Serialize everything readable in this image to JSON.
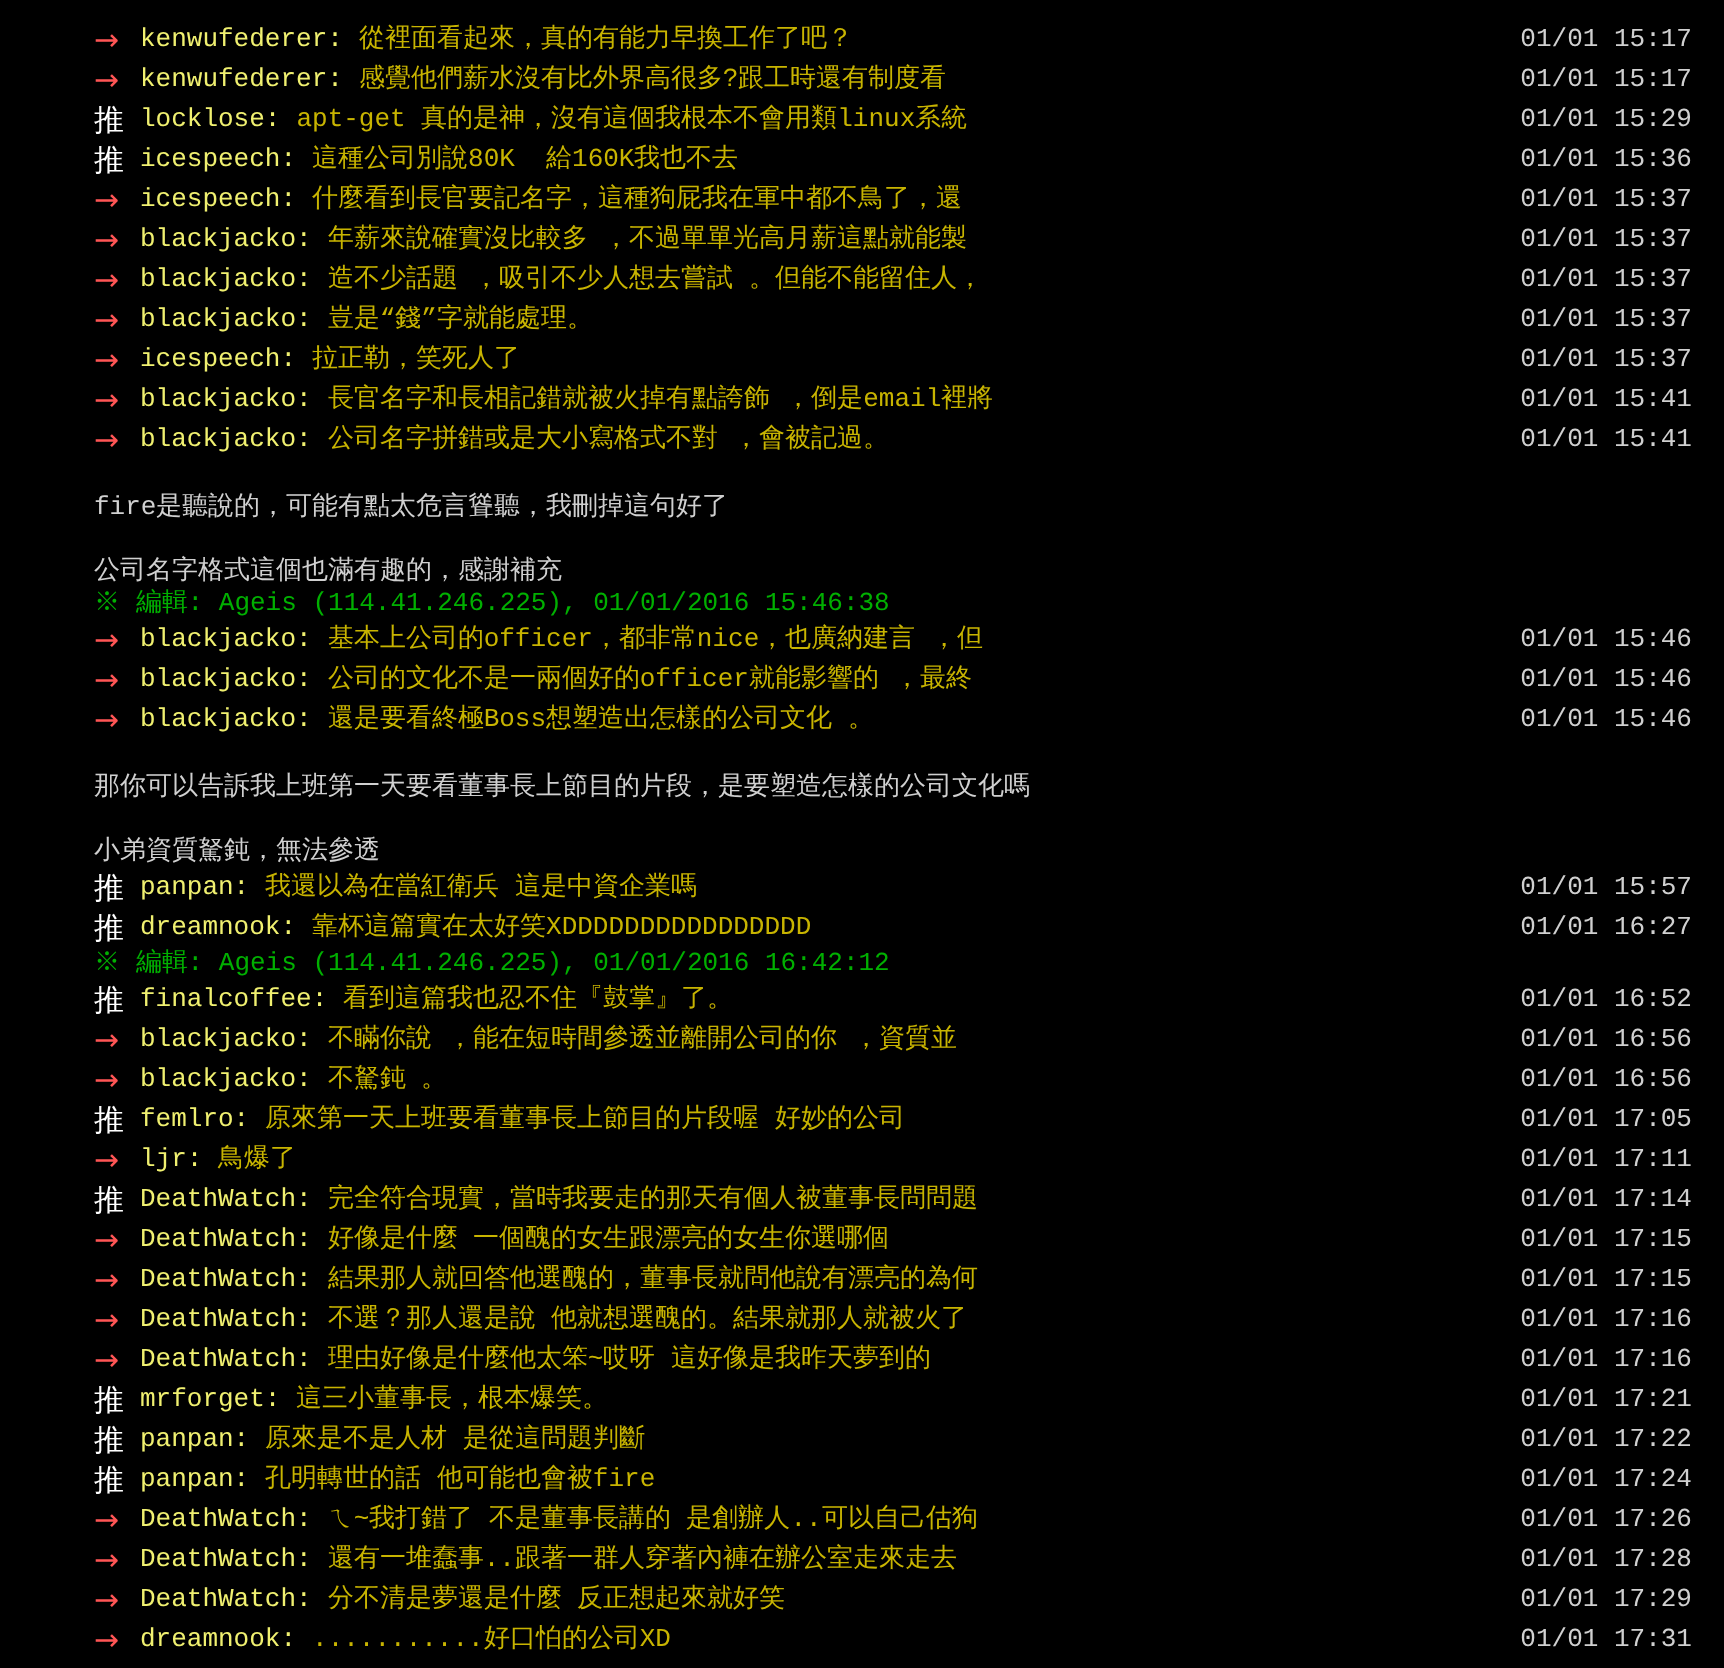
{
  "lines": [
    {
      "kind": "push",
      "tag": {
        "text": "→",
        "kind": "arrow"
      },
      "user": "kenwufederer:",
      "content": "從裡面看起來，真的有能力早換工作了吧？",
      "time": "01/01 15:17"
    },
    {
      "kind": "push",
      "tag": {
        "text": "→",
        "kind": "arrow"
      },
      "user": "kenwufederer:",
      "content": "感覺他們薪水沒有比外界高很多?跟工時還有制度看",
      "time": "01/01 15:17"
    },
    {
      "kind": "push",
      "tag": {
        "text": "推",
        "kind": "up"
      },
      "user": "locklose:",
      "content": "apt-get 真的是神，沒有這個我根本不會用類linux系統",
      "time": "01/01 15:29"
    },
    {
      "kind": "push",
      "tag": {
        "text": "推",
        "kind": "up"
      },
      "user": "icespeech:",
      "content": "這種公司別說80K  給160K我也不去",
      "time": "01/01 15:36"
    },
    {
      "kind": "push",
      "tag": {
        "text": "→",
        "kind": "arrow"
      },
      "user": "icespeech:",
      "content": "什麼看到長官要記名字，這種狗屁我在軍中都不鳥了，還",
      "time": "01/01 15:37"
    },
    {
      "kind": "push",
      "tag": {
        "text": "→",
        "kind": "arrow"
      },
      "user": "blackjacko:",
      "content": "年薪來說確實沒比較多 ，不過單單光高月薪這點就能製",
      "time": "01/01 15:37"
    },
    {
      "kind": "push",
      "tag": {
        "text": "→",
        "kind": "arrow"
      },
      "user": "blackjacko:",
      "content": "造不少話題 ，吸引不少人想去嘗試 。但能不能留住人，",
      "time": "01/01 15:37"
    },
    {
      "kind": "push",
      "tag": {
        "text": "→",
        "kind": "arrow"
      },
      "user": "blackjacko:",
      "content": "豈是“錢”字就能處理。",
      "time": "01/01 15:37"
    },
    {
      "kind": "push",
      "tag": {
        "text": "→",
        "kind": "arrow"
      },
      "user": "icespeech:",
      "content": "拉正勒，笑死人了",
      "time": "01/01 15:37"
    },
    {
      "kind": "push",
      "tag": {
        "text": "→",
        "kind": "arrow"
      },
      "user": "blackjacko:",
      "content": "長官名字和長相記錯就被火掉有點誇飾 ，倒是email裡將",
      "time": "01/01 15:41"
    },
    {
      "kind": "push",
      "tag": {
        "text": "→",
        "kind": "arrow"
      },
      "user": "blackjacko:",
      "content": "公司名字拼錯或是大小寫格式不對 ，會被記過。",
      "time": "01/01 15:41"
    },
    {
      "kind": "blank"
    },
    {
      "kind": "text",
      "text": "fire是聽說的，可能有點太危言聳聽，我刪掉這句好了"
    },
    {
      "kind": "blank"
    },
    {
      "kind": "text",
      "text": "公司名字格式這個也滿有趣的，感謝補充"
    },
    {
      "kind": "edit",
      "text": "※ 編輯: Ageis (114.41.246.225), 01/01/2016 15:46:38"
    },
    {
      "kind": "push",
      "tag": {
        "text": "→",
        "kind": "arrow"
      },
      "user": "blackjacko:",
      "content": "基本上公司的officer，都非常nice，也廣納建言 ，但",
      "time": "01/01 15:46"
    },
    {
      "kind": "push",
      "tag": {
        "text": "→",
        "kind": "arrow"
      },
      "user": "blackjacko:",
      "content": "公司的文化不是一兩個好的officer就能影響的 ，最終",
      "time": "01/01 15:46"
    },
    {
      "kind": "push",
      "tag": {
        "text": "→",
        "kind": "arrow"
      },
      "user": "blackjacko:",
      "content": "還是要看終極Boss想塑造出怎樣的公司文化 。",
      "time": "01/01 15:46"
    },
    {
      "kind": "blank"
    },
    {
      "kind": "text",
      "text": "那你可以告訴我上班第一天要看董事長上節目的片段，是要塑造怎樣的公司文化嗎"
    },
    {
      "kind": "blank"
    },
    {
      "kind": "text",
      "text": "小弟資質駑鈍，無法參透"
    },
    {
      "kind": "push",
      "tag": {
        "text": "推",
        "kind": "up"
      },
      "user": "panpan:",
      "content": "我還以為在當紅衛兵 這是中資企業嗎",
      "time": "01/01 15:57"
    },
    {
      "kind": "push",
      "tag": {
        "text": "推",
        "kind": "up"
      },
      "user": "dreamnook:",
      "content": "靠杯這篇實在太好笑XDDDDDDDDDDDDDDDD",
      "time": "01/01 16:27"
    },
    {
      "kind": "edit",
      "text": "※ 編輯: Ageis (114.41.246.225), 01/01/2016 16:42:12"
    },
    {
      "kind": "push",
      "tag": {
        "text": "推",
        "kind": "up"
      },
      "user": "finalcoffee:",
      "content": "看到這篇我也忍不住『鼓掌』了。",
      "time": "01/01 16:52"
    },
    {
      "kind": "push",
      "tag": {
        "text": "→",
        "kind": "arrow"
      },
      "user": "blackjacko:",
      "content": "不瞞你說 ，能在短時間參透並離開公司的你 ，資質並",
      "time": "01/01 16:56"
    },
    {
      "kind": "push",
      "tag": {
        "text": "→",
        "kind": "arrow"
      },
      "user": "blackjacko:",
      "content": "不駑鈍 。",
      "time": "01/01 16:56"
    },
    {
      "kind": "push",
      "tag": {
        "text": "推",
        "kind": "up"
      },
      "user": "femlro:",
      "content": "原來第一天上班要看董事長上節目的片段喔 好妙的公司",
      "time": "01/01 17:05"
    },
    {
      "kind": "push",
      "tag": {
        "text": "→",
        "kind": "arrow"
      },
      "user": "ljr:",
      "content": "鳥爆了",
      "time": "01/01 17:11"
    },
    {
      "kind": "push",
      "tag": {
        "text": "推",
        "kind": "up"
      },
      "user": "DeathWatch:",
      "content": "完全符合現實，當時我要走的那天有個人被董事長問問題",
      "time": "01/01 17:14"
    },
    {
      "kind": "push",
      "tag": {
        "text": "→",
        "kind": "arrow"
      },
      "user": "DeathWatch:",
      "content": "好像是什麼 一個醜的女生跟漂亮的女生你選哪個",
      "time": "01/01 17:15"
    },
    {
      "kind": "push",
      "tag": {
        "text": "→",
        "kind": "arrow"
      },
      "user": "DeathWatch:",
      "content": "結果那人就回答他選醜的，董事長就問他說有漂亮的為何",
      "time": "01/01 17:15"
    },
    {
      "kind": "push",
      "tag": {
        "text": "→",
        "kind": "arrow"
      },
      "user": "DeathWatch:",
      "content": "不選？那人還是說 他就想選醜的。結果就那人就被火了",
      "time": "01/01 17:16"
    },
    {
      "kind": "push",
      "tag": {
        "text": "→",
        "kind": "arrow"
      },
      "user": "DeathWatch:",
      "content": "理由好像是什麼他太笨~哎呀 這好像是我昨天夢到的",
      "time": "01/01 17:16"
    },
    {
      "kind": "push",
      "tag": {
        "text": "推",
        "kind": "up"
      },
      "user": "mrforget:",
      "content": "這三小董事長，根本爆笑。",
      "time": "01/01 17:21"
    },
    {
      "kind": "push",
      "tag": {
        "text": "推",
        "kind": "up"
      },
      "user": "panpan:",
      "content": "原來是不是人材 是從這問題判斷",
      "time": "01/01 17:22"
    },
    {
      "kind": "push",
      "tag": {
        "text": "推",
        "kind": "up"
      },
      "user": "panpan:",
      "content": "孔明轉世的話 他可能也會被fire",
      "time": "01/01 17:24"
    },
    {
      "kind": "push",
      "tag": {
        "text": "→",
        "kind": "arrow"
      },
      "user": "DeathWatch:",
      "content": "ㄟ~我打錯了 不是董事長講的 是創辦人..可以自己估狗",
      "time": "01/01 17:26"
    },
    {
      "kind": "push",
      "tag": {
        "text": "→",
        "kind": "arrow"
      },
      "user": "DeathWatch:",
      "content": "還有一堆蠢事..跟著一群人穿著內褲在辦公室走來走去",
      "time": "01/01 17:28"
    },
    {
      "kind": "push",
      "tag": {
        "text": "→",
        "kind": "arrow"
      },
      "user": "DeathWatch:",
      "content": "分不清是夢還是什麼 反正想起來就好笑",
      "time": "01/01 17:29"
    },
    {
      "kind": "push",
      "tag": {
        "text": "→",
        "kind": "arrow"
      },
      "user": "dreamnook:",
      "content": "...........好口怕的公司XD",
      "time": "01/01 17:31"
    }
  ]
}
